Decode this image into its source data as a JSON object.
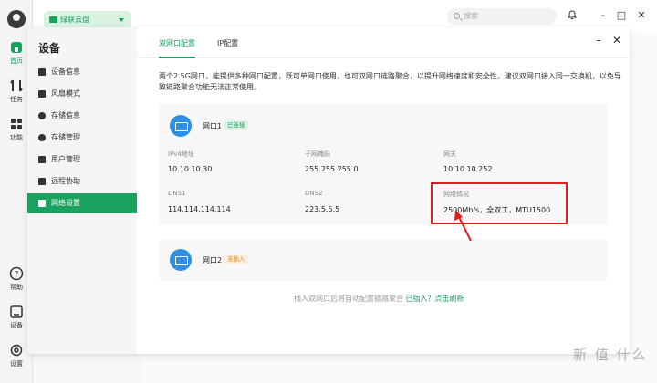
{
  "rail": {
    "items": [
      {
        "label": "首页"
      },
      {
        "label": "任务"
      },
      {
        "label": "功能"
      },
      {
        "label": "帮助"
      },
      {
        "label": "设备"
      },
      {
        "label": "设置"
      }
    ]
  },
  "appbar": {
    "drive_label": "绿联云盘",
    "search_placeholder": "搜索"
  },
  "modal": {
    "title": "设备",
    "side_items": [
      {
        "label": "设备信息"
      },
      {
        "label": "风扇模式"
      },
      {
        "label": "存储信息"
      },
      {
        "label": "存储管理"
      },
      {
        "label": "用户管理"
      },
      {
        "label": "远程协助"
      },
      {
        "label": "网络设置"
      }
    ],
    "tabs": [
      {
        "label": "双网口配置"
      },
      {
        "label": "IP配置"
      }
    ],
    "description": "两个2.5G网口，能提供多种网口配置，既可单网口使用，也可双网口链路聚合，以提升网络速度和安全性。建议双网口接入同一交换机，以免导致链路聚合功能无法正常使用。",
    "port1": {
      "name": "网口1",
      "status": "已连接",
      "fields": [
        {
          "label": "IPv4地址",
          "value": "10.10.10.30"
        },
        {
          "label": "子网掩码",
          "value": "255.255.255.0"
        },
        {
          "label": "网关",
          "value": "10.10.10.252"
        },
        {
          "label": "DNS1",
          "value": "114.114.114.114"
        },
        {
          "label": "DNS2",
          "value": "223.5.5.5"
        },
        {
          "label": "网络情况",
          "value": "2500Mb/s，全双工，MTU1500"
        }
      ]
    },
    "port2": {
      "name": "网口2",
      "status": "未插入"
    },
    "footer_text": "插入双网口后将自动配置链路聚合",
    "footer_link": "已插入？点击刷新"
  },
  "watermark": "新 值 什么",
  "colors": {
    "accent": "#1aa160",
    "port_icon": "#2f8ee6",
    "highlight": "#e02020",
    "warn": "#e38b22"
  }
}
